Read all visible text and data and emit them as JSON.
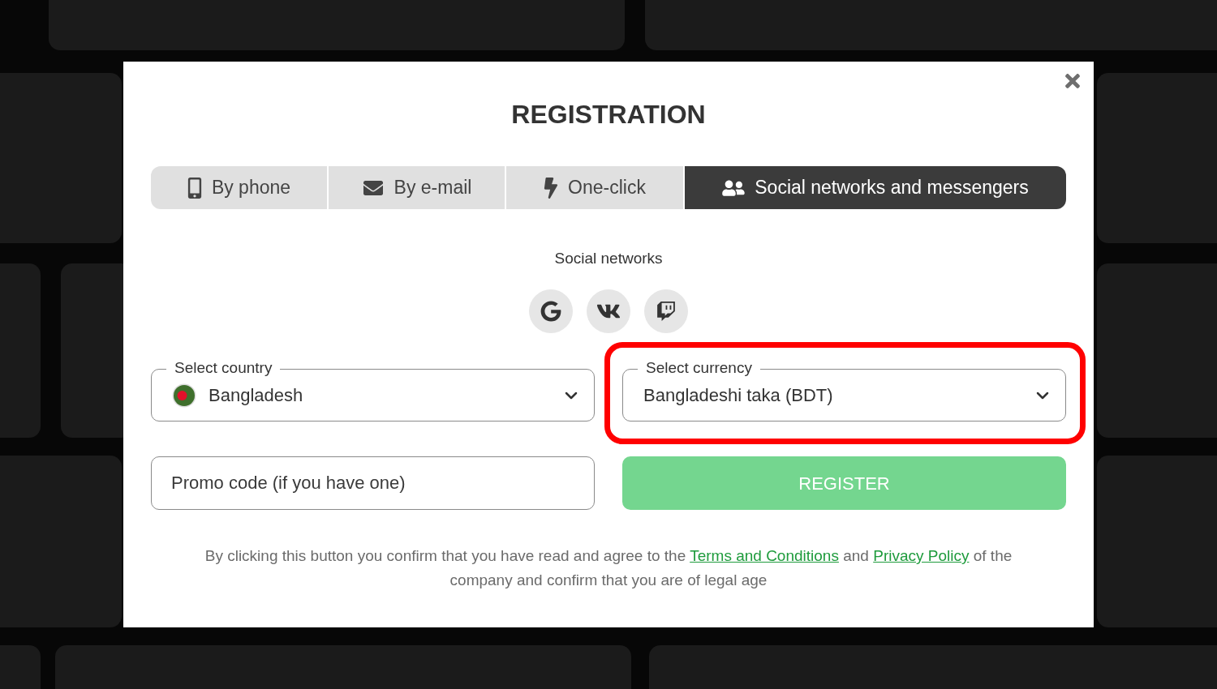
{
  "dialog": {
    "title": "REGISTRATION"
  },
  "tabs": [
    {
      "label": "By phone",
      "selected": false
    },
    {
      "label": "By e-mail",
      "selected": false
    },
    {
      "label": "One-click",
      "selected": false
    },
    {
      "label": "Social networks and messengers",
      "selected": true
    }
  ],
  "social_networks": {
    "heading": "Social networks"
  },
  "country_select": {
    "label": "Select country",
    "value": "Bangladesh"
  },
  "currency_select": {
    "label": "Select currency",
    "value": "Bangladeshi taka (BDT)",
    "highlighted": true
  },
  "promo_field": {
    "placeholder": "Promo code (if you have one)"
  },
  "register_button": {
    "label": "REGISTER"
  },
  "consent": [
    {
      "kind": "text",
      "text": "By clicking this button you confirm that you have read and agree to the "
    },
    {
      "kind": "link",
      "text": "Terms and Conditions"
    },
    {
      "kind": "text",
      "text": " and "
    },
    {
      "kind": "link",
      "text": "Privacy Policy"
    },
    {
      "kind": "text",
      "text": " of the company and confirm that you are of legal age"
    }
  ]
}
